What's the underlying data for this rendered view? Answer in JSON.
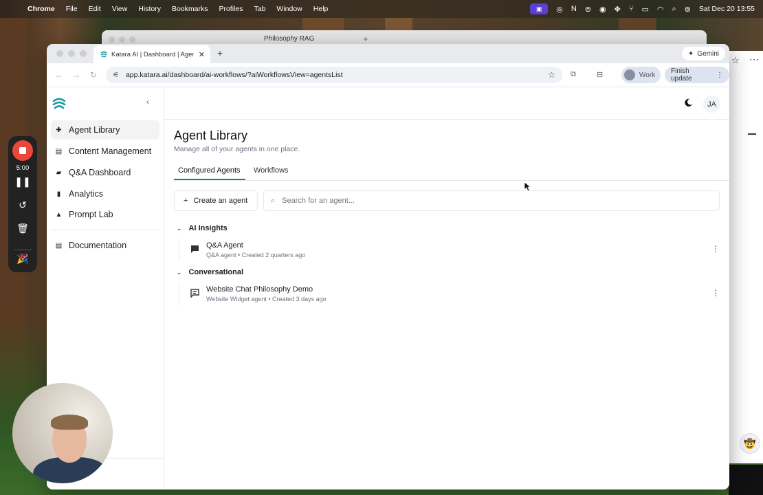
{
  "menubar": {
    "app_name": "Chrome",
    "items": [
      "File",
      "Edit",
      "View",
      "History",
      "Bookmarks",
      "Profiles",
      "Tab",
      "Window",
      "Help"
    ],
    "datetime": "Sat Dec 20  13:55"
  },
  "background_window": {
    "tab_title": "Philosophy RAG"
  },
  "browser": {
    "tab_title": "Katara AI | Dashboard | Agen",
    "new_tab_symbol": "+",
    "gemini_label": "Gemini",
    "url": "app.katara.ai/dashboard/ai-workflows/?aiWorkflowsView=agentsList",
    "profile_label": "Work",
    "update_label": "Finish update"
  },
  "sidebar": {
    "items": [
      {
        "label": "Agent Library",
        "icon": "puzzle-icon"
      },
      {
        "label": "Content Management",
        "icon": "document-icon"
      },
      {
        "label": "Q&A Dashboard",
        "icon": "chat-icon"
      },
      {
        "label": "Analytics",
        "icon": "bar-chart-icon"
      },
      {
        "label": "Prompt Lab",
        "icon": "flask-icon"
      },
      {
        "label": "Documentation",
        "icon": "book-icon"
      }
    ]
  },
  "header": {
    "avatar_initials": "JA"
  },
  "main": {
    "title": "Agent Library",
    "subtitle": "Manage all of your agents in one place.",
    "tabs": [
      "Configured Agents",
      "Workflows"
    ],
    "create_label": "Create an agent",
    "search_placeholder": "Search for an agent...",
    "groups": [
      {
        "name": "AI Insights",
        "agents": [
          {
            "name": "Q&A Agent",
            "type": "Q&A agent",
            "created": "Created 2 quarters ago"
          }
        ]
      },
      {
        "name": "Conversational",
        "agents": [
          {
            "name": "Website Chat Philosophy Demo",
            "type": "Website Widget agent",
            "created": "Created 3 days ago"
          }
        ]
      }
    ]
  },
  "recording": {
    "time": "5:00"
  },
  "colors": {
    "accent": "#1e7f8a",
    "record": "#e8473b",
    "sidebar_active": "#f1f3f5"
  }
}
